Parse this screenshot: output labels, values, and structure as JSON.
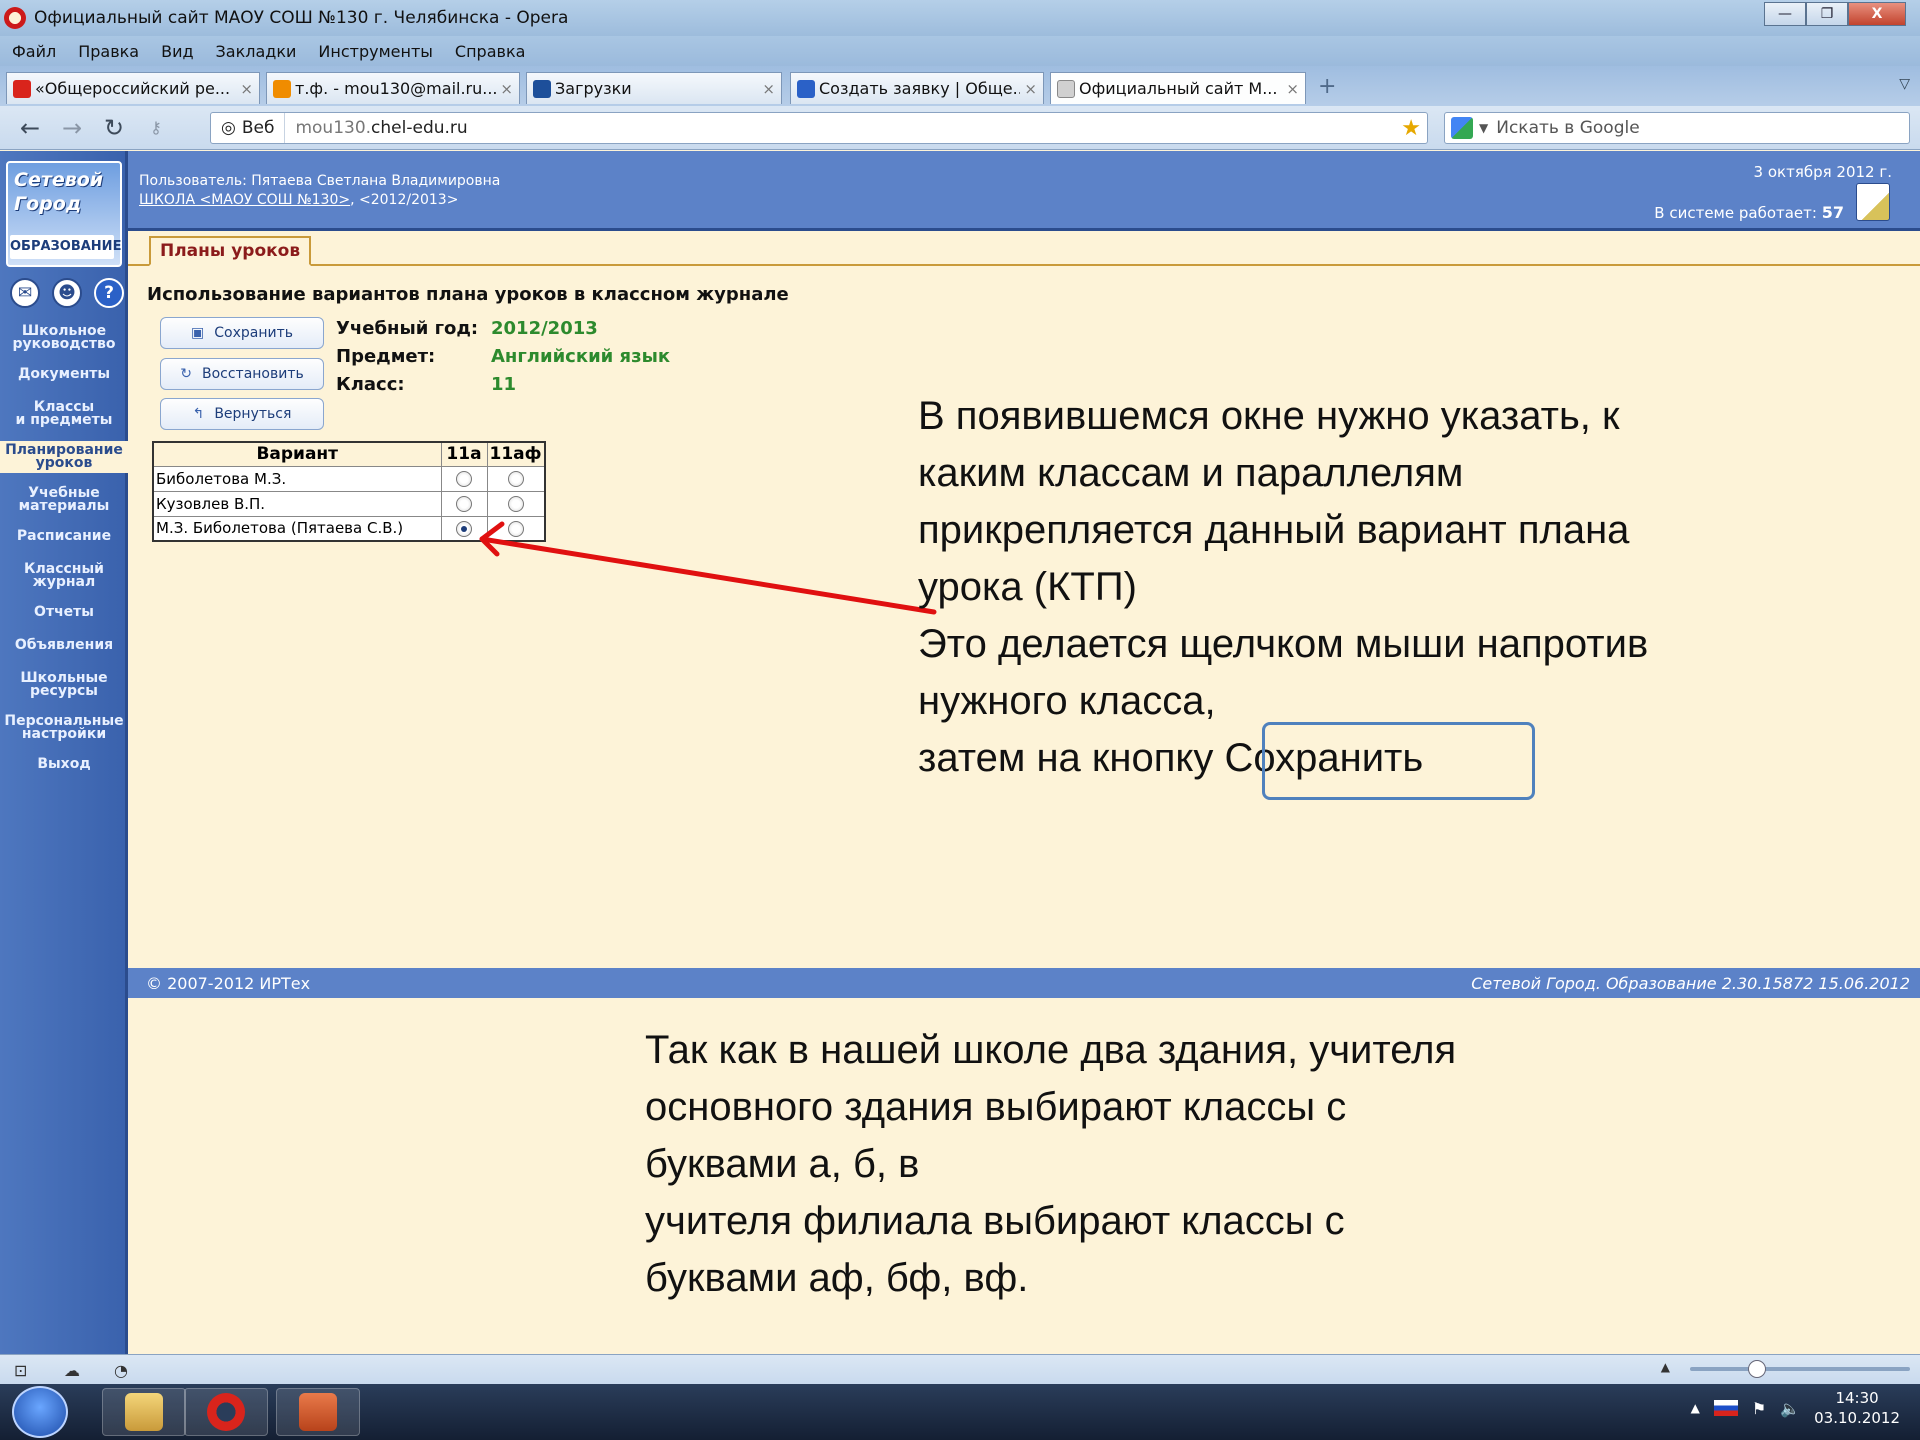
{
  "window": {
    "title": "Официальный сайт МАОУ СОШ №130 г. Челябинска - Opera",
    "controls": [
      "—",
      "❐",
      "X"
    ]
  },
  "menu": [
    "Файл",
    "Правка",
    "Вид",
    "Закладки",
    "Инструменты",
    "Справка"
  ],
  "tabs": [
    {
      "label": "«Общероссийский ре...",
      "icon": "yandex-icon",
      "color": "#d9241c"
    },
    {
      "label": "т.ф. - mou130@mail.ru...",
      "icon": "mail-icon",
      "color": "#f08c00"
    },
    {
      "label": "Загрузки",
      "icon": "downloads-icon",
      "color": "#1d4f9a"
    },
    {
      "label": "Создать заявку | Обще...",
      "icon": "form-icon",
      "color": "#2b61c7"
    },
    {
      "label": "Официальный сайт М...",
      "icon": "page-icon",
      "color": "#888888"
    }
  ],
  "address": {
    "web_label": "Веб",
    "url_prefix": "mou130.",
    "url_domain": "chel-edu.ru",
    "search_placeholder": "Искать в Google"
  },
  "site": {
    "logo_line1": "Сетевой",
    "logo_line2": "Город",
    "logo_line3": "ОБРАЗОВАНИЕ",
    "user_line": "Пользователь: Пятаева Светлана Владимировна",
    "school_link": "ШКОЛА <МАОУ СОШ №130>",
    "school_year_tag": ",  <2012/2013>",
    "date": "3 октября 2012 г.",
    "online_label": "В системе работает: ",
    "online_count": "57"
  },
  "sidebar_nav": [
    {
      "label": "Школьное\nруководство"
    },
    {
      "label": "Документы"
    },
    {
      "label": "Классы\nи предметы"
    },
    {
      "label": "Планирование\nуроков",
      "active": true
    },
    {
      "label": "Учебные\nматериалы"
    },
    {
      "label": "Расписание"
    },
    {
      "label": "Классный\nжурнал"
    },
    {
      "label": "Отчеты"
    },
    {
      "label": "Объявления"
    },
    {
      "label": "Школьные\nресурсы"
    },
    {
      "label": "Персональные\nнастройки"
    },
    {
      "label": "Выход"
    }
  ],
  "page_tab": "Планы уроков",
  "content": {
    "title": "Использование вариантов плана уроков в классном журнале",
    "buttons": {
      "save": "Сохранить",
      "restore": "Восстановить",
      "back": "Вернуться"
    },
    "info": {
      "year_label": "Учебный год:",
      "year_value": "2012/2013",
      "subject_label": "Предмет:",
      "subject_value": "Английский язык",
      "class_label": "Класс:",
      "class_value": "11"
    },
    "variants_table": {
      "headers": [
        "Вариант",
        "11а",
        "11аф"
      ],
      "rows": [
        {
          "name": "Биболетова М.З.",
          "c11a": false,
          "c11af": false
        },
        {
          "name": "Кузовлев В.П.",
          "c11a": false,
          "c11af": false
        },
        {
          "name": "М.З. Биболетова (Пятаева С.В.)",
          "c11a": true,
          "c11af": false
        }
      ]
    }
  },
  "annotations": {
    "callout1": [
      "В появившемся окне нужно указать, к",
      "каким классам и параллелям",
      "прикрепляется данный  вариант плана",
      "урока (КТП)",
      "Это делается щелчком мыши напротив",
      "нужного класса,",
      "затем на кнопку Сохранить"
    ],
    "callout2": [
      "Так как в нашей школе два здания, учителя",
      "основного здания выбирают классы с",
      "буквами а, б, в",
      "учителя филиала выбирают классы с",
      "буквами аф, бф, вф."
    ],
    "arrow_color": "#e01010",
    "highlight_color": "#4f81bd"
  },
  "footer": {
    "copyright": "© 2007-2012 ИРТех",
    "version": "Сетевой Город. Образование 2.30.15872   15.06.2012"
  },
  "taskbar": {
    "time": "14:30",
    "date": "03.10.2012"
  }
}
